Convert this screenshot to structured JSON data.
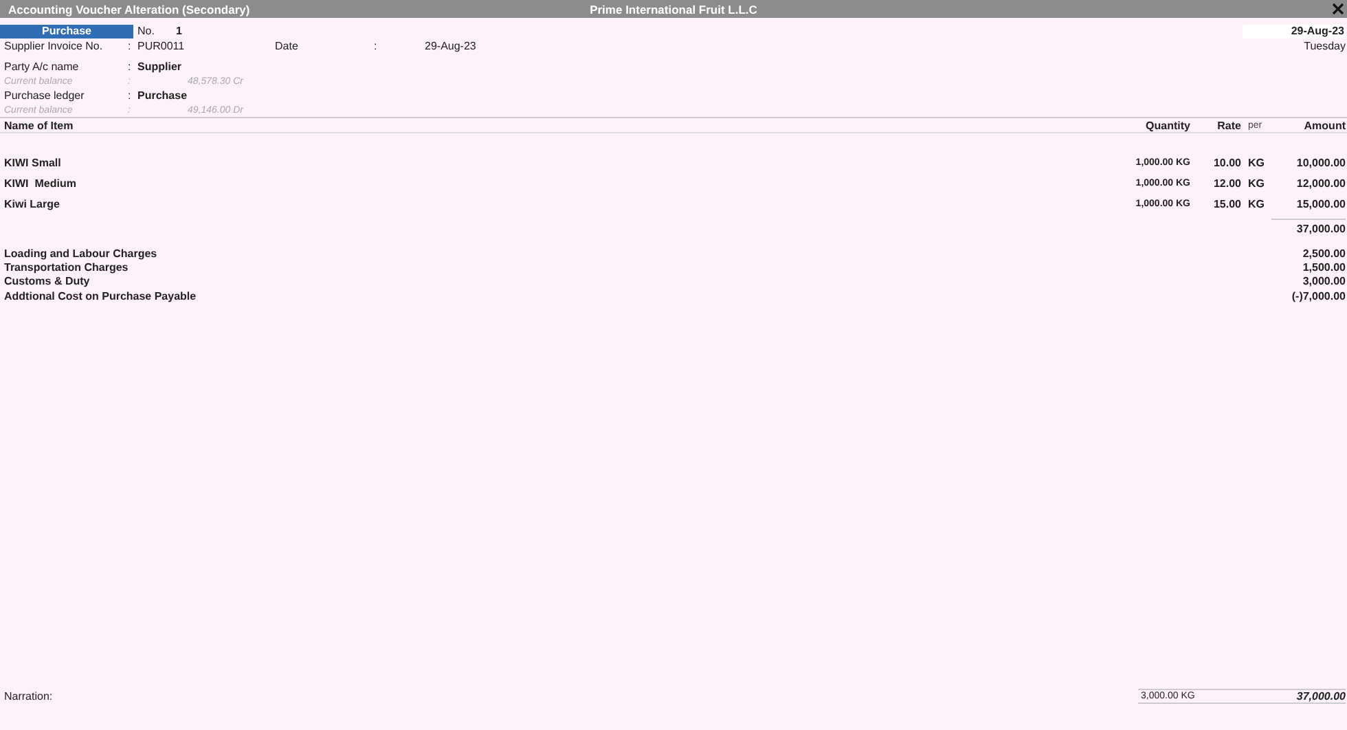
{
  "window": {
    "title": "Accounting Voucher Alteration (Secondary)",
    "company": "Prime International Fruit L.L.C"
  },
  "voucher": {
    "type": "Purchase",
    "number_label": "No.",
    "number": "1",
    "date": "29-Aug-23",
    "day": "Tuesday"
  },
  "invoice": {
    "label": "Supplier Invoice No.",
    "separator": ":",
    "value": "PUR0011",
    "date_label": "Date",
    "date_separator": ":",
    "date_value": "29-Aug-23"
  },
  "ledgers": [
    {
      "label": "Party A/c name",
      "separator": ":",
      "value": "Supplier",
      "balance_label": "Current balance",
      "balance_separator": ":",
      "balance": "48,578.30 Cr"
    },
    {
      "label": "Purchase ledger",
      "separator": ":",
      "value": "Purchase",
      "balance_label": "Current balance",
      "balance_separator": ":",
      "balance": "49,146.00 Dr"
    }
  ],
  "table": {
    "columns": [
      "Name of Item",
      "Quantity",
      "Rate",
      "per",
      "Amount"
    ],
    "rows": [
      {
        "name": "KIWI Small",
        "quantity": "1,000.00 KG",
        "rate": "10.00",
        "per": "KG",
        "amount": "10,000.00"
      },
      {
        "name": "KIWI  Medium",
        "quantity": "1,000.00 KG",
        "rate": "12.00",
        "per": "KG",
        "amount": "12,000.00"
      },
      {
        "name": "Kiwi Large",
        "quantity": "1,000.00 KG",
        "rate": "15.00",
        "per": "KG",
        "amount": "15,000.00"
      }
    ],
    "subtotal": "37,000.00",
    "charges": [
      {
        "name": "Loading and Labour Charges",
        "amount": "2,500.00"
      },
      {
        "name": "Transportation Charges",
        "amount": "1,500.00"
      },
      {
        "name": "Customs & Duty",
        "amount": "3,000.00"
      },
      {
        "name": "Addtional Cost on Purchase Payable",
        "amount": "(-)7,000.00"
      }
    ]
  },
  "footer": {
    "narration_label": "Narration:",
    "total_quantity": "3,000.00 KG",
    "total_amount": "37,000.00"
  }
}
